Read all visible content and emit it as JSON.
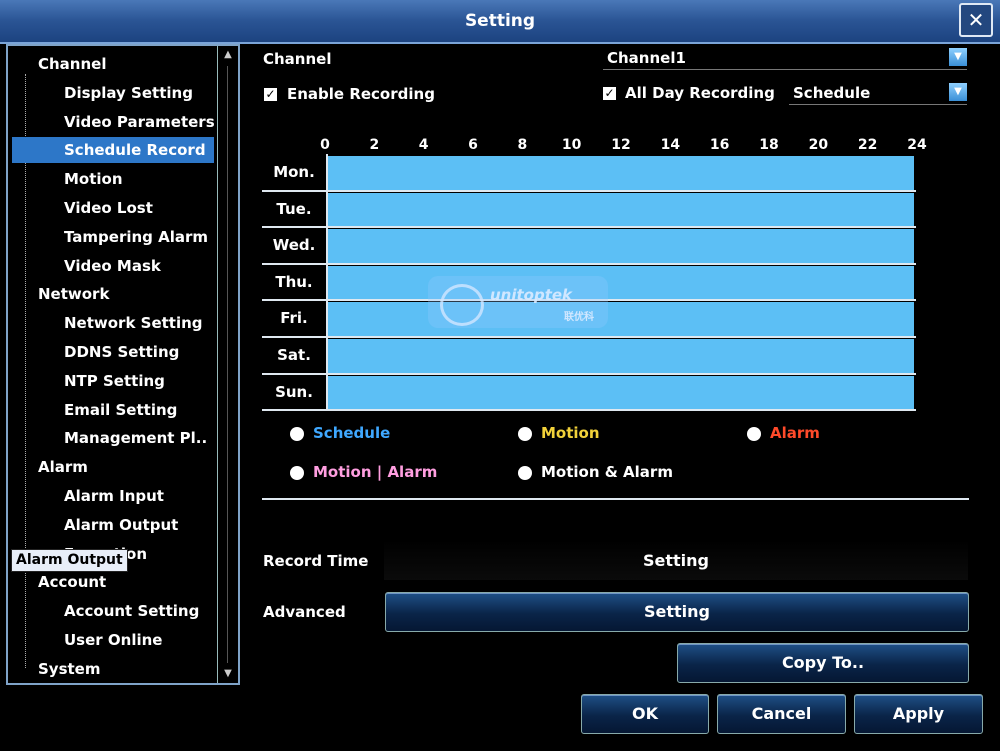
{
  "window": {
    "title": "Setting",
    "close_glyph": "✕"
  },
  "sidebar": {
    "items": [
      {
        "label": "Channel",
        "level": 0
      },
      {
        "label": "Display Setting",
        "level": 1
      },
      {
        "label": "Video Parameters",
        "level": 1
      },
      {
        "label": "Schedule Record",
        "level": 1,
        "selected": true
      },
      {
        "label": "Motion",
        "level": 1
      },
      {
        "label": "Video Lost",
        "level": 1
      },
      {
        "label": "Tampering Alarm",
        "level": 1
      },
      {
        "label": "Video Mask",
        "level": 1
      },
      {
        "label": "Network",
        "level": 0
      },
      {
        "label": "Network Setting",
        "level": 1
      },
      {
        "label": "DDNS Setting",
        "level": 1
      },
      {
        "label": "NTP Setting",
        "level": 1
      },
      {
        "label": "Email Setting",
        "level": 1
      },
      {
        "label": "Management Pl..",
        "level": 1
      },
      {
        "label": "Alarm",
        "level": 0
      },
      {
        "label": "Alarm Input",
        "level": 1
      },
      {
        "label": "Alarm Output",
        "level": 1
      },
      {
        "label": "Exception",
        "level": 1
      },
      {
        "label": "Account",
        "level": 0
      },
      {
        "label": "Account Setting",
        "level": 1
      },
      {
        "label": "User Online",
        "level": 1
      },
      {
        "label": "System",
        "level": 0
      }
    ],
    "tooltip": "Alarm Output"
  },
  "main": {
    "channel_label": "Channel",
    "channel_value": "Channel1",
    "enable_recording_label": "Enable Recording",
    "enable_recording_checked": true,
    "all_day_label": "All Day Recording",
    "all_day_checked": true,
    "record_type_value": "Schedule",
    "hours": [
      "0",
      "2",
      "4",
      "6",
      "8",
      "10",
      "12",
      "14",
      "16",
      "18",
      "20",
      "22",
      "24"
    ],
    "days": [
      "Mon.",
      "Tue.",
      "Wed.",
      "Thu.",
      "Fri.",
      "Sat.",
      "Sun."
    ],
    "schedule_fill_color": "#5cbff5",
    "legend": [
      {
        "label": "Schedule",
        "color": "#3fa8ff"
      },
      {
        "label": "Motion",
        "color": "#f2d23a"
      },
      {
        "label": "Alarm",
        "color": "#ff4a2a"
      },
      {
        "label": "Motion | Alarm",
        "color": "#ff9ee0"
      },
      {
        "label": "Motion & Alarm",
        "color": "#ffffff"
      }
    ],
    "record_time_label": "Record Time",
    "record_time_setting": "Setting",
    "advanced_label": "Advanced",
    "advanced_setting": "Setting",
    "copy_to": "Copy To..",
    "ok": "OK",
    "cancel": "Cancel",
    "apply": "Apply"
  },
  "watermark": {
    "text": "unitoptek",
    "cn": "联优科"
  }
}
